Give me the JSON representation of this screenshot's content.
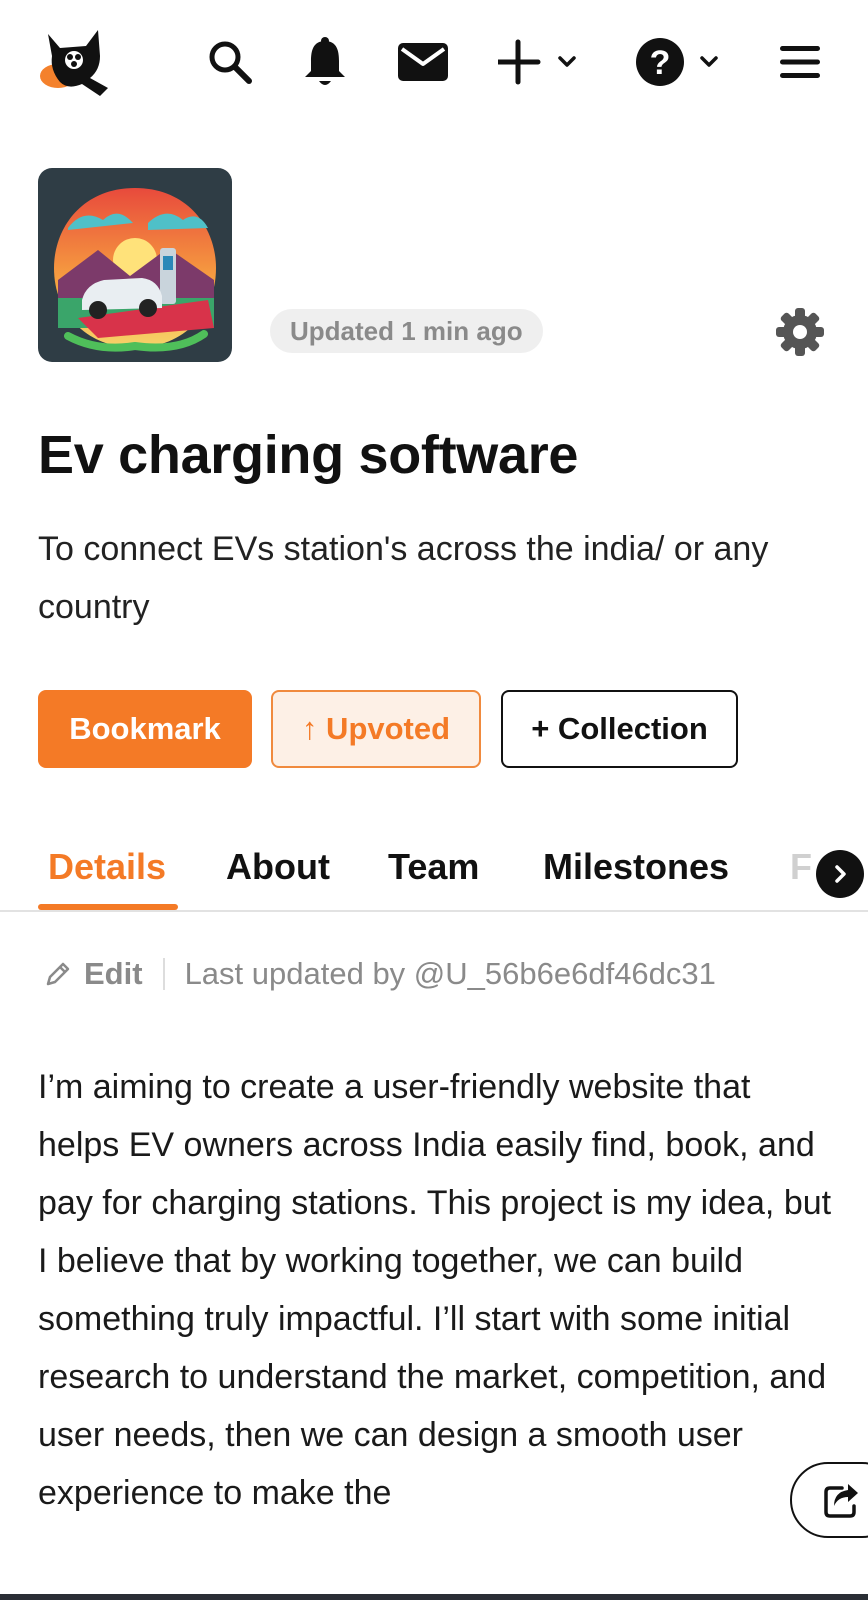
{
  "nav": {
    "logo": "cat-logo",
    "icons": [
      "search-icon",
      "bell-icon",
      "mail-icon",
      "plus-icon",
      "chevron-down-icon",
      "help-icon",
      "menu-icon"
    ]
  },
  "project": {
    "image": "ev-charging-illustration",
    "updated": "Updated 1 min ago",
    "title": "Ev charging software",
    "tagline": "To connect EVs station's across the india/ or any country"
  },
  "actions": {
    "bookmark": "Bookmark",
    "upvoted": "↑ Upvoted",
    "collection": "+ Collection"
  },
  "tabs": {
    "details": "Details",
    "about": "About",
    "team": "Team",
    "milestones": "Milestones",
    "next_partial": "F"
  },
  "edit_row": {
    "edit": "Edit",
    "last_updated": "Last updated by @U_56b6e6df46dc31"
  },
  "description": "I’m aiming to create a user-friendly website that helps EV owners across India easily find, book, and pay for charging stations. This project is my idea, but I believe that by working together, we can build something truly impactful. I’ll start with some initial research to understand the market, competition, and user needs, then we can design a smooth user experience to make the",
  "colors": {
    "accent": "#f47a26",
    "accent_light": "#fdf0e6",
    "muted_text": "#8a8a8a",
    "text": "#111111"
  }
}
